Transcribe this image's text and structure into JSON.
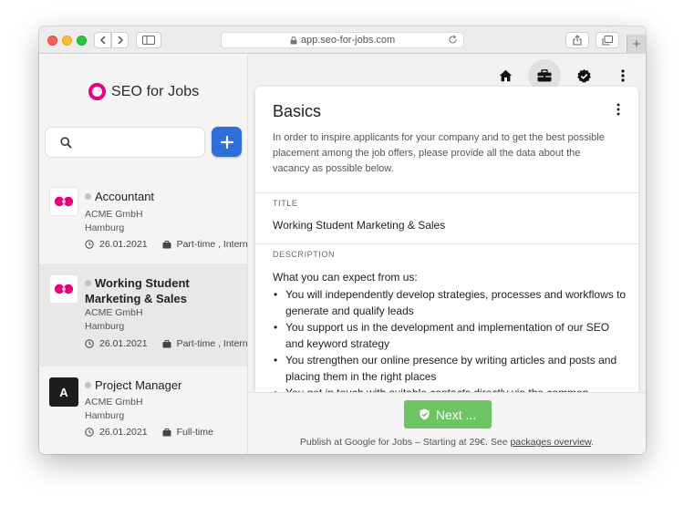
{
  "browser": {
    "url": "app.seo-for-jobs.com"
  },
  "app": {
    "logo_text": "SEO for Jobs",
    "brand_color": "#e6007e",
    "accent_color": "#2f6fd8"
  },
  "sidebar": {
    "search": {
      "value": "",
      "placeholder": ""
    },
    "jobs": [
      {
        "title": "Accountant",
        "company": "ACME GmbH",
        "city": "Hamburg",
        "date": "26.01.2021",
        "type": "Part-time , Interns",
        "logo": "pink-dots-icon",
        "selected": false
      },
      {
        "title": "Working Student Marketing & Sales",
        "company": "ACME GmbH",
        "city": "Hamburg",
        "date": "26.01.2021",
        "type": "Part-time , Interns",
        "logo": "pink-dots-icon",
        "selected": true
      },
      {
        "title": "Project Manager",
        "company": "ACME GmbH",
        "city": "Hamburg",
        "date": "26.01.2021",
        "type": "Full-time",
        "logo": "letter-a-icon",
        "logo_letter": "A",
        "selected": false
      }
    ]
  },
  "main": {
    "card": {
      "title": "Basics",
      "intro": "In order to inspire applicants for your company and to get the best possible placement among the job offers, please provide all the data about the vacancy as possible below.",
      "title_label": "TITLE",
      "title_value": "Working Student Marketing & Sales",
      "description_label": "DESCRIPTION",
      "description_intro": "What you can expect from us:",
      "description_items": [
        "You will independently develop strategies, processes and workflows to generate and qualify leads",
        "You support us in the development and implementation of our SEO and keyword strategy",
        "You strengthen our online presence by writing articles and posts and placing them in the right places",
        "You get in touch with suitable contacts directly via the common"
      ]
    },
    "footer": {
      "next_label": "Next ...",
      "publish_text": "Publish at Google for Jobs – Starting at 29€. See ",
      "publish_link": "packages overview",
      "publish_end": "."
    }
  }
}
